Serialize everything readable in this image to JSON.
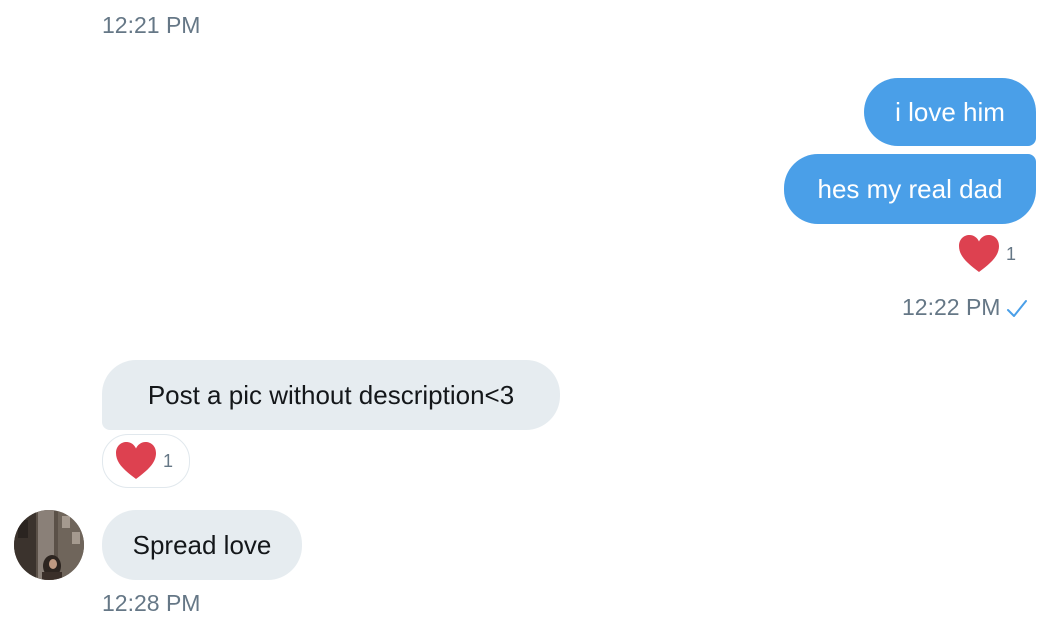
{
  "conversation": {
    "timestamp_top": "12:21 PM",
    "messages": [
      {
        "text": "i love him",
        "from": "me"
      },
      {
        "text": "hes my real dad",
        "from": "me"
      },
      {
        "text": "Post a pic without description<3",
        "from": "them"
      },
      {
        "text": "Spread love",
        "from": "them"
      }
    ],
    "reaction_sent": {
      "emoji": "heart-icon",
      "count": "1"
    },
    "timestamp_sent": "12:22 PM",
    "reaction_received": {
      "emoji": "heart-icon",
      "count": "1"
    },
    "timestamp_bottom": "12:28 PM"
  },
  "colors": {
    "sent_bubble": "#4a9fe8",
    "received_bubble": "#e6ecf0",
    "heart": "#dd4150",
    "meta_text": "#657786",
    "read_check": "#4a9fe8"
  }
}
